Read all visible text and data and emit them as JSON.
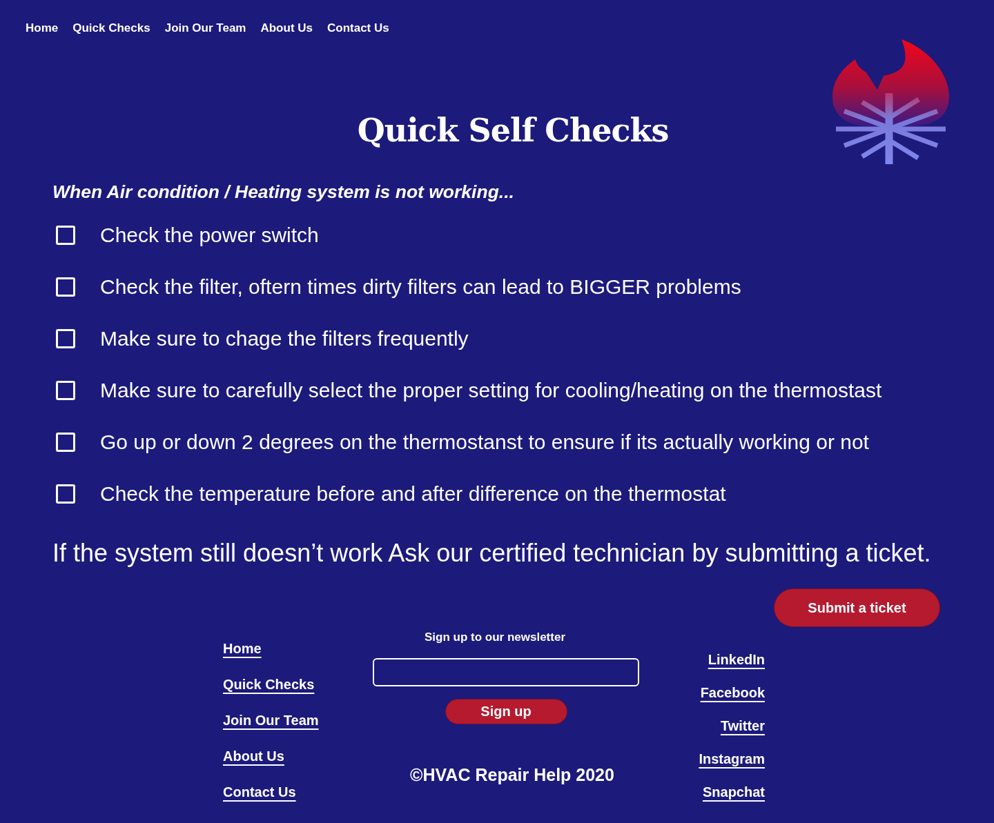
{
  "nav": {
    "links": [
      "Home",
      "Quick Checks",
      "Join Our Team",
      "About Us",
      "Contact Us"
    ]
  },
  "title": "Quick Self Checks",
  "subtitle": "When Air condition / Heating system is not working...",
  "checklist": [
    {
      "label": "Check the power switch",
      "checked": false
    },
    {
      "label": "Check the filter, oftern times dirty filters can lead to BIGGER problems",
      "checked": false
    },
    {
      "label": "Make sure to chage the filters frequently",
      "checked": false
    },
    {
      "label": "Make sure to carefully select the proper setting for cooling/heating on the thermostast",
      "checked": false
    },
    {
      "label": "Go up or down 2 degrees on the thermostanst to ensure if its actually working or not",
      "checked": false
    },
    {
      "label": "Check the temperature before and after difference on the thermostat",
      "checked": false
    }
  ],
  "closing": "If the system still doesn’t work Ask our certified technician by submitting a ticket.",
  "ticket_button": "Submit a ticket",
  "footer": {
    "links": [
      "Home",
      "Quick Checks",
      "Join Our Team",
      "About Us",
      "Contact Us"
    ],
    "newsletter": {
      "label": "Sign up to our newsletter",
      "button": "Sign up"
    },
    "copyright": "©HVAC Repair Help 2020",
    "social": [
      "LinkedIn",
      "Facebook",
      "Twitter",
      "Instagram",
      "Snapchat"
    ]
  }
}
